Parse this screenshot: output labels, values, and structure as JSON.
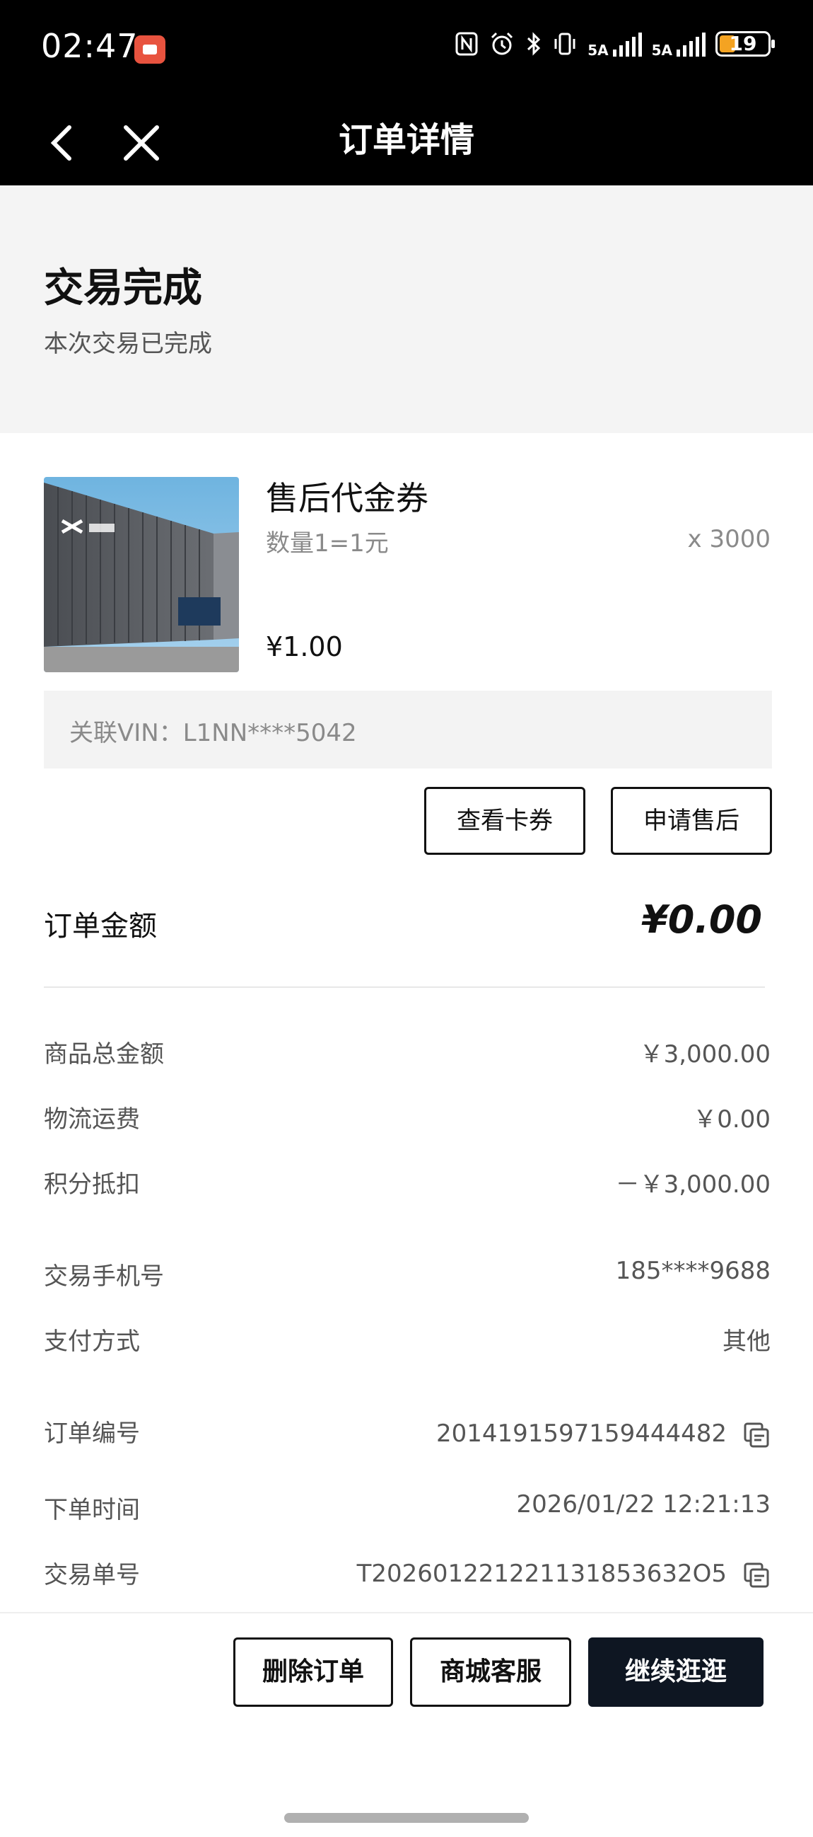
{
  "status_bar": {
    "time": "02:47",
    "network_1": "5A",
    "network_2": "5A",
    "battery_level": "19",
    "icons": [
      "nfc-icon",
      "alarm-icon",
      "bluetooth-icon",
      "vibrate-icon",
      "signal-icon",
      "signal-icon",
      "battery-icon"
    ],
    "battery_color": "#f4a322"
  },
  "nav": {
    "title": "订单详情",
    "back_icon": "chevron-left-icon",
    "close_icon": "close-icon"
  },
  "order_status": {
    "title": "交易完成",
    "subtitle": "本次交易已完成"
  },
  "product": {
    "name": "售后代金券",
    "spec": "数量1=1元",
    "quantity": "x 3000",
    "price": "¥1.00",
    "vin": "关联VIN：L1NN****5042"
  },
  "actions": {
    "view_card": "查看卡券",
    "after_sale": "申请售后"
  },
  "amount": {
    "label": "订单金额",
    "value": "¥0.00"
  },
  "cost_rows": [
    {
      "label": "商品总金额",
      "value": "￥3,000.00"
    },
    {
      "label": "物流运费",
      "value": "￥0.00"
    },
    {
      "label": "积分抵扣",
      "value": "－￥3,000.00"
    }
  ],
  "info_rows": [
    {
      "label": "交易手机号",
      "value": "185****9688"
    },
    {
      "label": "支付方式",
      "value": "其他"
    },
    {
      "label": "订单编号",
      "value": "2014191597159444482"
    },
    {
      "label": "下单时间",
      "value": "2026/01/22 12:21:13"
    },
    {
      "label": "交易单号",
      "value": "T202601221221131853632O5"
    }
  ],
  "bottom": {
    "delete": "删除订单",
    "service": "商城客服",
    "continue": "继续逛逛",
    "continue_bg": "#0e1622"
  }
}
